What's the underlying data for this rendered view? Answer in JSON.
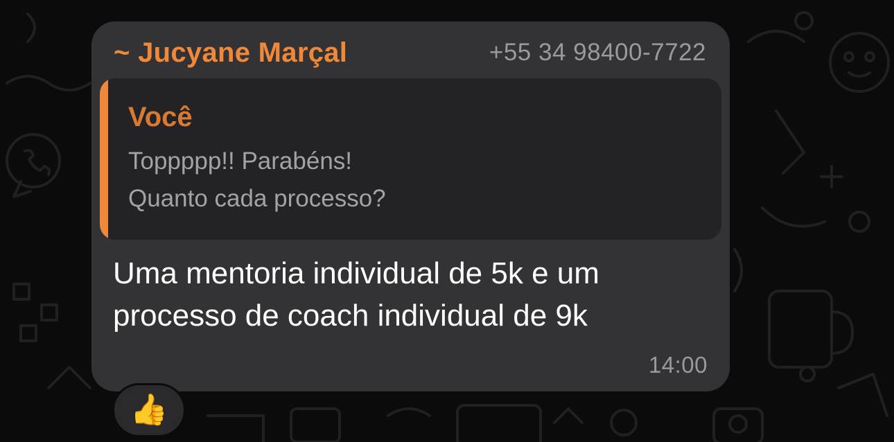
{
  "message": {
    "sender_name": "~ Jucyane Marçal",
    "sender_phone": "+55 34 98400-7722",
    "quoted": {
      "author": "Você",
      "lines": [
        "Toppppp!! Parabéns!",
        "Quanto cada processo?"
      ]
    },
    "text_lines": [
      "Uma mentoria individual de 5k e um",
      "processo de coach individual de 9k"
    ],
    "time": "14:00"
  },
  "reaction": {
    "emoji": "👍",
    "icon": "thumbs-up-icon"
  },
  "colors": {
    "background": "#0b0b0b",
    "bubble": "#333335",
    "quote_bg": "#232325",
    "accent": "#f0883a",
    "secondary_text": "#9a9a9d"
  }
}
